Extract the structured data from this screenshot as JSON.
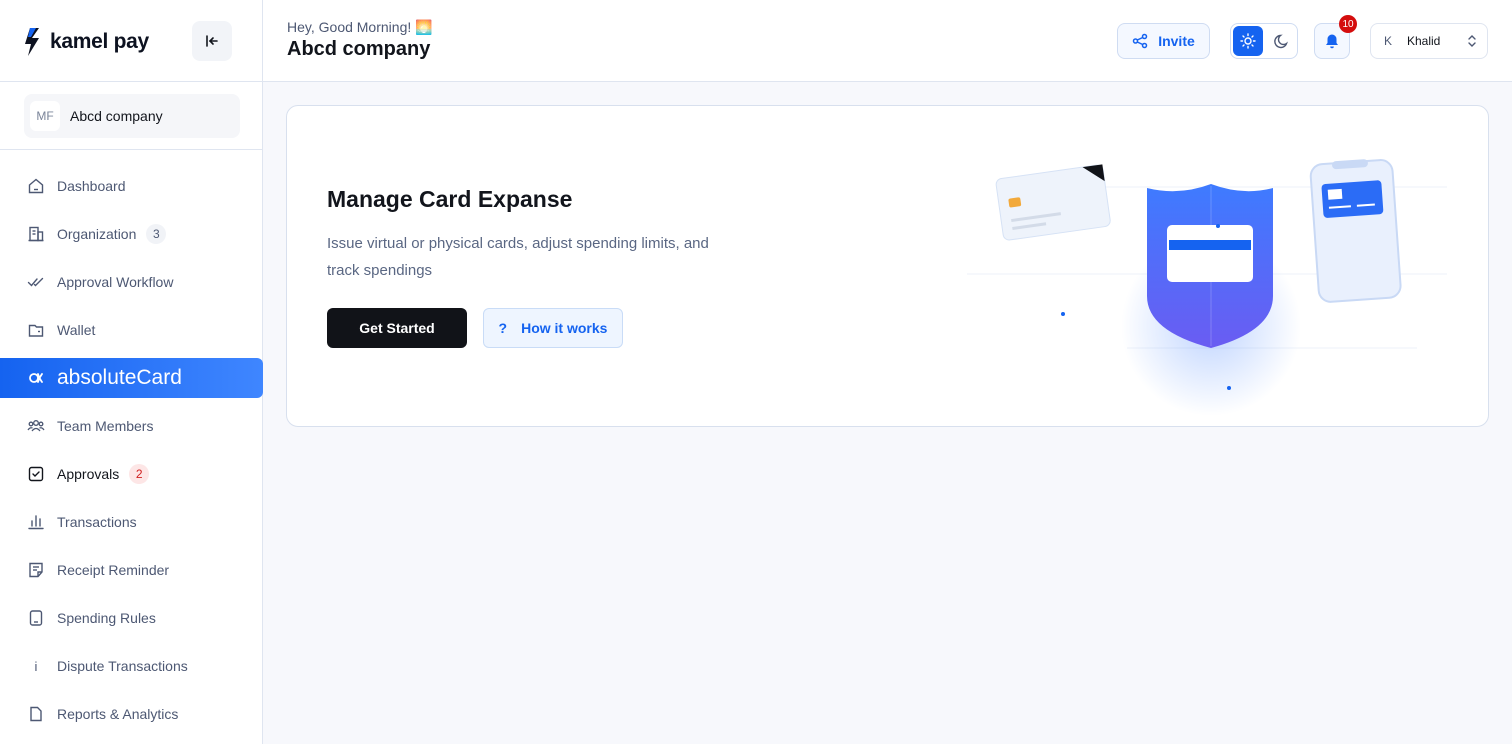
{
  "brand": {
    "name": "kamel pay",
    "accent": "#1563f0"
  },
  "sidebar": {
    "company": {
      "initials": "MF",
      "name": "Abcd company"
    },
    "items": [
      {
        "label": "Dashboard",
        "icon": "home-icon"
      },
      {
        "label": "Organization",
        "icon": "building-icon",
        "badge": "3"
      },
      {
        "label": "Approval Workflow",
        "icon": "double-check-icon"
      },
      {
        "label": "Wallet",
        "icon": "wallet-icon"
      },
      {
        "label": "absoluteCard",
        "icon": "alpha-icon",
        "active": true
      },
      {
        "label": "Team Members",
        "icon": "users-icon"
      },
      {
        "label": "Approvals",
        "icon": "checkbox-icon",
        "badge": "2"
      },
      {
        "label": "Transactions",
        "icon": "bar-chart-icon"
      },
      {
        "label": "Receipt Reminder",
        "icon": "receipt-icon"
      },
      {
        "label": "Spending Rules",
        "icon": "bookmark-icon"
      },
      {
        "label": "Dispute Transactions",
        "icon": "info-icon",
        "glyph": "i"
      },
      {
        "label": "Reports & Analytics",
        "icon": "document-icon"
      }
    ]
  },
  "header": {
    "greeting": "Hey, Good Morning! 🌅",
    "title": "Abcd company",
    "invite_label": "Invite",
    "notification_count": "10",
    "user": {
      "initial": "K",
      "name": "Khalid"
    }
  },
  "hero": {
    "title": "Manage Card Expanse",
    "description": "Issue virtual or physical cards, adjust spending limits, and track spendings",
    "primary_label": "Get Started",
    "secondary_icon": "?",
    "secondary_label": "How it works"
  }
}
